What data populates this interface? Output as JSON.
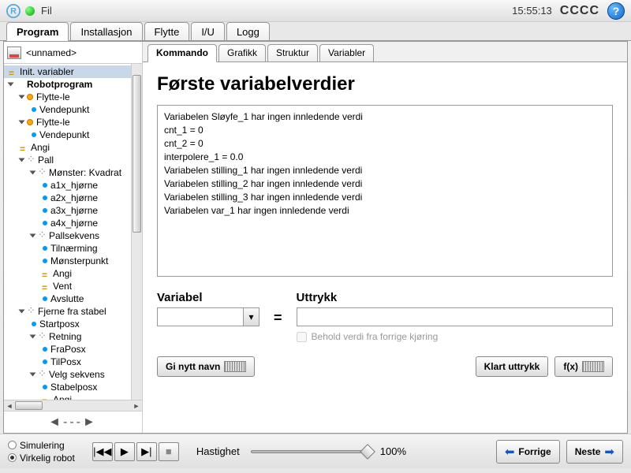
{
  "topbar": {
    "menu": "Fil",
    "clock": "15:55:13",
    "cccc": "CCCC",
    "help": "?"
  },
  "main_tabs": [
    "Program",
    "Installasjon",
    "Flytte",
    "I/U",
    "Logg"
  ],
  "file_name": "<unnamed>",
  "tree": [
    {
      "label": "Init. variabler",
      "depth": 0,
      "icon": "eq",
      "selected": true
    },
    {
      "label": "Robotprogram",
      "depth": 0,
      "icon": "tri-open"
    },
    {
      "label": "Flytte-le",
      "depth": 1,
      "icon": "move",
      "tri": true
    },
    {
      "label": "Vendepunkt",
      "depth": 2,
      "icon": "dot"
    },
    {
      "label": "Flytte-le",
      "depth": 1,
      "icon": "move",
      "tri": true
    },
    {
      "label": "Vendepunkt",
      "depth": 2,
      "icon": "dot"
    },
    {
      "label": "Angi",
      "depth": 1,
      "icon": "eq"
    },
    {
      "label": "Pall",
      "depth": 1,
      "icon": "pts",
      "tri": true
    },
    {
      "label": "Mønster: Kvadrat",
      "depth": 2,
      "icon": "pts",
      "tri": true
    },
    {
      "label": "a1x_hjørne",
      "depth": 3,
      "icon": "dot"
    },
    {
      "label": "a2x_hjørne",
      "depth": 3,
      "icon": "dot"
    },
    {
      "label": "a3x_hjørne",
      "depth": 3,
      "icon": "dot"
    },
    {
      "label": "a4x_hjørne",
      "depth": 3,
      "icon": "dot"
    },
    {
      "label": "Pallsekvens",
      "depth": 2,
      "icon": "pts",
      "tri": true
    },
    {
      "label": "Tilnærming",
      "depth": 3,
      "icon": "dot"
    },
    {
      "label": "Mønsterpunkt",
      "depth": 3,
      "icon": "dot"
    },
    {
      "label": "Angi",
      "depth": 3,
      "icon": "eq"
    },
    {
      "label": "Vent",
      "depth": 3,
      "icon": "eq"
    },
    {
      "label": "Avslutte",
      "depth": 3,
      "icon": "dot"
    },
    {
      "label": "Fjerne fra stabel",
      "depth": 1,
      "icon": "pts",
      "tri": true
    },
    {
      "label": "Startposx",
      "depth": 2,
      "icon": "dot"
    },
    {
      "label": "Retning",
      "depth": 2,
      "icon": "pts",
      "tri": true
    },
    {
      "label": "FraPosx",
      "depth": 3,
      "icon": "dot"
    },
    {
      "label": "TilPosx",
      "depth": 3,
      "icon": "dot"
    },
    {
      "label": "Velg sekvens",
      "depth": 2,
      "icon": "pts",
      "tri": true
    },
    {
      "label": "Stabelposx",
      "depth": 3,
      "icon": "dot"
    },
    {
      "label": "Angi",
      "depth": 3,
      "icon": "eq"
    }
  ],
  "sub_tabs": [
    "Kommando",
    "Grafikk",
    "Struktur",
    "Variabler"
  ],
  "panel": {
    "title": "Første variabelverdier",
    "lines": [
      "Variabelen Sløyfe_1 har ingen innledende verdi",
      "cnt_1 = 0",
      "cnt_2 = 0",
      "interpolere_1 = 0.0",
      "Variabelen stilling_1 har ingen innledende verdi",
      "Variabelen stilling_2 har ingen innledende verdi",
      "Variabelen stilling_3 har ingen innledende verdi",
      "Variabelen var_1 har ingen innledende verdi"
    ],
    "var_label": "Variabel",
    "expr_label": "Uttrykk",
    "eq": "=",
    "keep": "Behold verdi fra forrige kjøring",
    "rename": "Gi nytt navn",
    "clear": "Klart uttrykk",
    "fx": "f(x)"
  },
  "bottom": {
    "sim": "Simulering",
    "real": "Virkelig robot",
    "speed_label": "Hastighet",
    "speed_val": "100%",
    "prev": "Forrige",
    "next": "Neste"
  }
}
